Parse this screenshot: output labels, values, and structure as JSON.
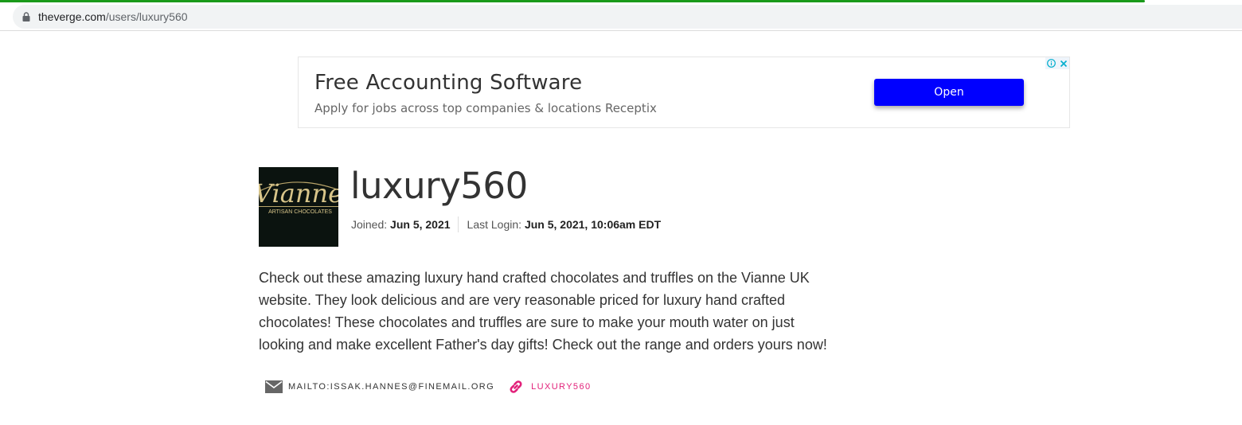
{
  "browser": {
    "url_domain": "theverge.com",
    "url_path": "/users/luxury560"
  },
  "ad": {
    "title": "Free Accounting Software",
    "subtitle": "Apply for jobs across top companies & locations Receptix",
    "button_label": "Open",
    "button_color": "#0000ff"
  },
  "profile": {
    "avatar_brand": "Vianne",
    "avatar_tagline": "ARTISAN CHOCOLATES",
    "username": "luxury560",
    "joined_label": "Joined:",
    "joined_value": "Jun 5, 2021",
    "last_login_label": "Last Login:",
    "last_login_value": "Jun 5, 2021, 10:06am EDT",
    "bio": "Check out these amazing luxury hand crafted chocolates and truffles on the Vianne UK website. They look delicious and are very reasonable priced for luxury hand crafted chocolates! These chocolates and truffles are sure to make your mouth water on just looking and make excellent Father's day gifts! Check out the range and orders yours now!",
    "email_link": "MAILTO:ISSAK.HANNES@FINEMAIL.ORG",
    "website_link": "LUXURY560",
    "accent_color": "#e2217a"
  }
}
